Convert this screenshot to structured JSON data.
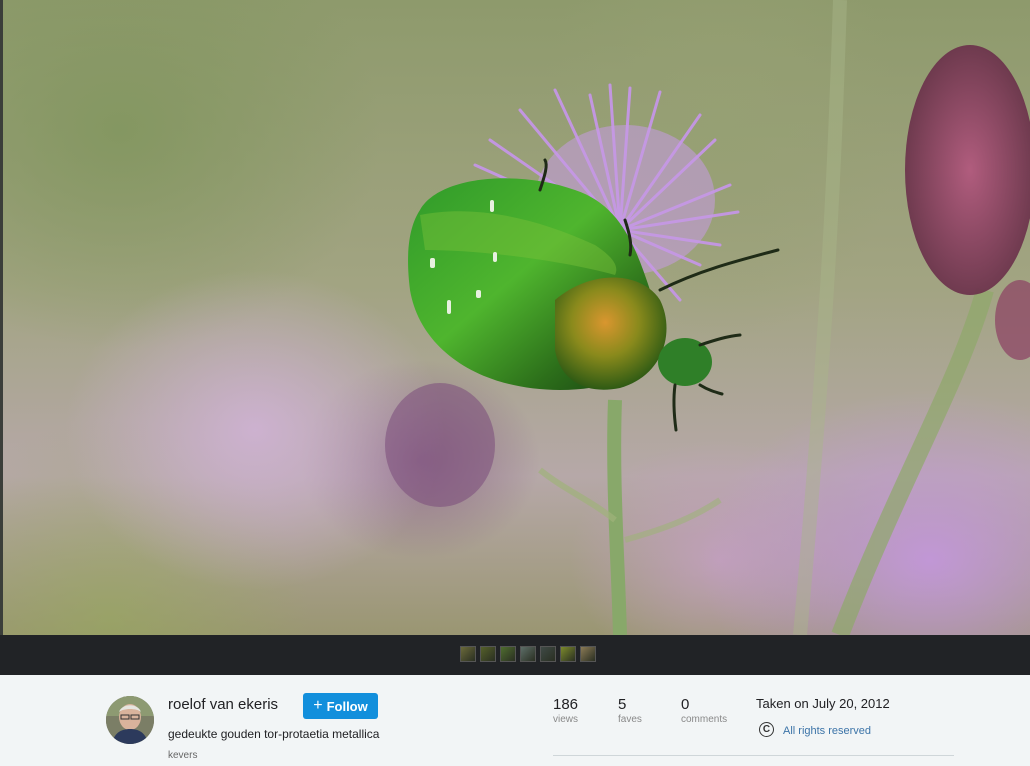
{
  "photo": {
    "icon": "beetle-on-thistle-photo"
  },
  "filmstrip": {
    "thumbnails": [
      {
        "color": "#6b6a3a"
      },
      {
        "color": "#55602a"
      },
      {
        "color": "#4f6d2f"
      },
      {
        "color": "#5d6e68"
      },
      {
        "color": "#3f4a46"
      },
      {
        "color": "#7c8a2c"
      },
      {
        "color": "#8a7a55"
      }
    ]
  },
  "author": {
    "name": "roelof van ekeris",
    "avatar_icon": "user-avatar"
  },
  "follow_button": {
    "label": "Follow",
    "icon": "plus-icon"
  },
  "photo_info": {
    "title": "gedeukte gouden tor-protaetia metallica",
    "album": "kevers"
  },
  "stats": {
    "views": {
      "value": "186",
      "label": "views"
    },
    "faves": {
      "value": "5",
      "label": "faves"
    },
    "comments": {
      "value": "0",
      "label": "comments"
    }
  },
  "taken": "Taken on July 20, 2012",
  "license": {
    "icon": "copyright-icon",
    "text": "All rights reserved"
  },
  "colors": {
    "accent": "#128fdc",
    "link": "#3c74a8",
    "filmstrip_bg": "#212326",
    "panel_bg": "#f2f5f6"
  }
}
